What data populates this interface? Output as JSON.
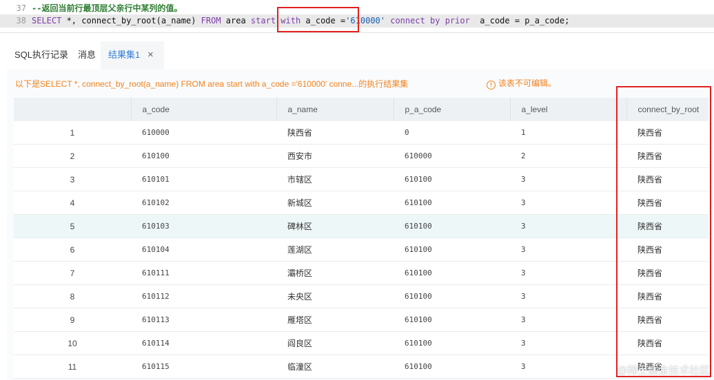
{
  "editor": {
    "line37": {
      "number": "37",
      "comment": "--返回当前行最顶层父亲行中某列的值。"
    },
    "line38": {
      "number": "38",
      "tokens": [
        {
          "t": "SELECT",
          "c": "kw"
        },
        {
          "t": " *, connect_by_root(a_name) ",
          "c": "plain"
        },
        {
          "t": "FROM",
          "c": "kw"
        },
        {
          "t": " area ",
          "c": "plain"
        },
        {
          "t": "start with",
          "c": "kw"
        },
        {
          "t": " a_code =",
          "c": "plain"
        },
        {
          "t": "'610000'",
          "c": "str"
        },
        {
          "t": " connect by prior",
          "c": "kw"
        },
        {
          "t": "  a_code = p_a_code;",
          "c": "plain"
        }
      ]
    }
  },
  "tabs": [
    {
      "label": "SQL执行记录"
    },
    {
      "label": "消息"
    },
    {
      "label": "结果集1"
    }
  ],
  "tab_close": "×",
  "result": {
    "info": "以下是SELECT *, connect_by_root(a_name) FROM area start with a_code ='610000' conne...的执行结果集",
    "warning": "该表不可编辑。",
    "warning_icon": "!"
  },
  "table": {
    "columns": [
      "",
      "a_code",
      "a_name",
      "p_a_code",
      "a_level",
      "connect_by_root"
    ],
    "rows": [
      [
        "1",
        "610000",
        "陕西省",
        "0",
        "1",
        "陕西省"
      ],
      [
        "2",
        "610100",
        "西安市",
        "610000",
        "2",
        "陕西省"
      ],
      [
        "3",
        "610101",
        "市辖区",
        "610100",
        "3",
        "陕西省"
      ],
      [
        "4",
        "610102",
        "新城区",
        "610100",
        "3",
        "陕西省"
      ],
      [
        "5",
        "610103",
        "碑林区",
        "610100",
        "3",
        "陕西省"
      ],
      [
        "6",
        "610104",
        "莲湖区",
        "610100",
        "3",
        "陕西省"
      ],
      [
        "7",
        "610111",
        "灞桥区",
        "610100",
        "3",
        "陕西省"
      ],
      [
        "8",
        "610112",
        "未央区",
        "610100",
        "3",
        "陕西省"
      ],
      [
        "9",
        "610113",
        "雁塔区",
        "610100",
        "3",
        "陕西省"
      ],
      [
        "10",
        "610114",
        "阎良区",
        "610100",
        "3",
        "陕西省"
      ],
      [
        "11",
        "610115",
        "临潼区",
        "610100",
        "3",
        "陕西省"
      ]
    ],
    "highlighted_row": 4
  },
  "watermark": "@稀土掘金技术社区",
  "colors": {
    "keyword": "#7b3fa8",
    "string": "#1a5fb4",
    "comment": "#2e7d32",
    "info": "#f0821e",
    "active_tab": "#2f7fd6",
    "annotation": "#e02020",
    "row_highlight": "#eef7f8"
  }
}
